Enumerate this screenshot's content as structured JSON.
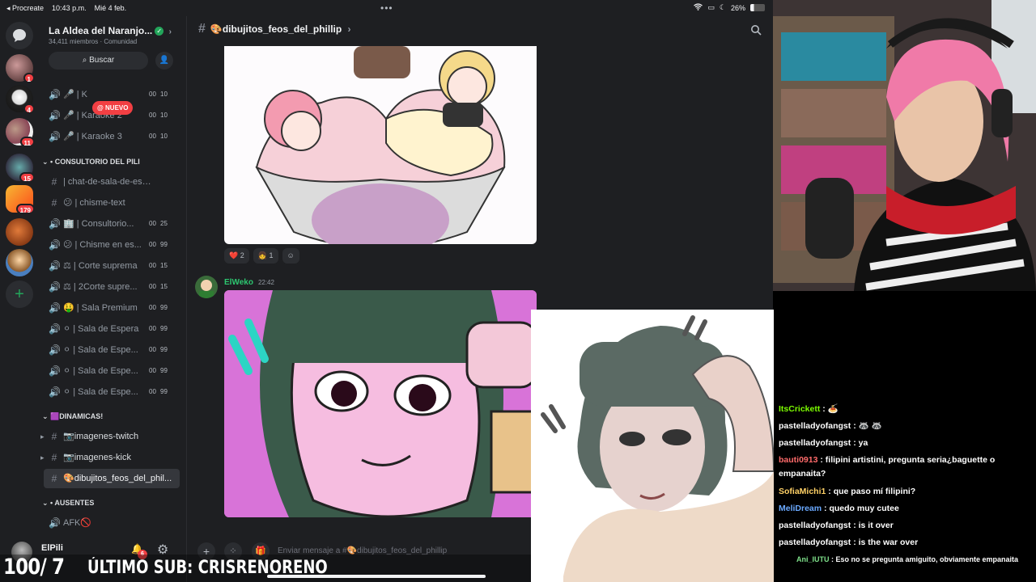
{
  "statusbar": {
    "app": "◂ Procreate",
    "time": "10:43 p.m.",
    "date": "Mié 4 feb.",
    "battery": "26%"
  },
  "server": {
    "name": "La Aldea del Naranjo...",
    "members": "34,411 miembros",
    "community": "Comunidad",
    "search": "Buscar",
    "new_badge": "@ NUEVO"
  },
  "rail": {
    "badges": [
      "1",
      "4",
      "11",
      "15",
      "179"
    ]
  },
  "channels": [
    {
      "icon": "🔊",
      "name": "🎤 | K",
      "c1": "00",
      "c2": "10"
    },
    {
      "icon": "🔊",
      "name": "🎤 | Karaoke 2",
      "c1": "00",
      "c2": "10"
    },
    {
      "icon": "🔊",
      "name": "🎤 | Karaoke 3",
      "c1": "00",
      "c2": "10"
    },
    {
      "icon": "#",
      "name": "| chat-de-sala-de-espera",
      "c1": "",
      "c2": ""
    },
    {
      "icon": "#",
      "name": "😕 | chisme-text",
      "c1": "",
      "c2": ""
    },
    {
      "icon": "🔊",
      "name": "🏢 | Consultorio...",
      "c1": "00",
      "c2": "25"
    },
    {
      "icon": "🔊",
      "name": "😕 | Chisme en es...",
      "c1": "00",
      "c2": "99"
    },
    {
      "icon": "🔊",
      "name": "⚖ | Corte suprema",
      "c1": "00",
      "c2": "15"
    },
    {
      "icon": "🔊",
      "name": "⚖ | 2Corte supre...",
      "c1": "00",
      "c2": "15"
    },
    {
      "icon": "🔊",
      "name": "🤑 | Sala Premium",
      "c1": "00",
      "c2": "99"
    },
    {
      "icon": "🔊",
      "name": "⚪ | Sala de Espera",
      "c1": "00",
      "c2": "99"
    },
    {
      "icon": "🔊",
      "name": "⚪ | Sala de Espe...",
      "c1": "00",
      "c2": "99"
    },
    {
      "icon": "🔊",
      "name": "⚪ | Sala de Espe...",
      "c1": "00",
      "c2": "99"
    },
    {
      "icon": "🔊",
      "name": "⚪ | Sala de Espe...",
      "c1": "00",
      "c2": "99"
    }
  ],
  "categories": {
    "consultorio": "CONSULTORIO DEL PILI",
    "dinamicas": "🟪DINAMICAS!",
    "ausentes": "AUSENTES"
  },
  "dinamicas_channels": [
    {
      "icon": "#",
      "name": "📷imagenes-twitch"
    },
    {
      "icon": "#",
      "name": "📷imagenes-kick"
    },
    {
      "icon": "#",
      "name": "🎨dibujitos_feos_del_phil..."
    }
  ],
  "afk": "AFK🚫",
  "user": {
    "name": "ElPili",
    "badge": "6"
  },
  "chat_header": "🎨dibujitos_feos_del_phillip",
  "reactions": [
    {
      "emoji": "❤️",
      "count": "2"
    },
    {
      "emoji": "👧",
      "count": "1"
    },
    {
      "emoji": "☺",
      "count": ""
    }
  ],
  "message": {
    "author": "ElWeko",
    "time": "22:42"
  },
  "composer_placeholder": "Enviar mensaje a #🎨dibujitos_feos_del_phillip",
  "stream_chat": [
    {
      "user": "ItsCrickett",
      "color": "#7cfc00",
      "text": "🍝"
    },
    {
      "user": "pastelladyofangst",
      "color": "#ffffff",
      "text": "🦝 🦝"
    },
    {
      "user": "pastelladyofangst",
      "color": "#ffffff",
      "text": "ya"
    },
    {
      "user": "bauti0913",
      "color": "#ff6b6b",
      "text": "filipini artistini, pregunta seria¿baguette o empanaita?"
    },
    {
      "user": "SofiaMichi1",
      "color": "#ffd166",
      "text": "que paso mí filipini?"
    },
    {
      "user": "MeliDream",
      "color": "#6aa9ff",
      "text": "quedo muy cutee"
    },
    {
      "user": "pastelladyofangst",
      "color": "#ffffff",
      "text": "is it over"
    },
    {
      "user": "pastelladyofangst",
      "color": "#ffffff",
      "text": "is the war over"
    },
    {
      "user": "Ani_IUTU",
      "color": "#7ee08a",
      "text": "Eso no se pregunta amiguito, obviamente empanaita"
    }
  ],
  "overlay": {
    "counter": "100/ 7",
    "last_sub": "ÚLTIMO SUB: CRISRENORENO"
  },
  "colors": {
    "discord_bg": "#1e1f22",
    "accent_green": "#23a55a",
    "mention_red": "#f23f43"
  }
}
